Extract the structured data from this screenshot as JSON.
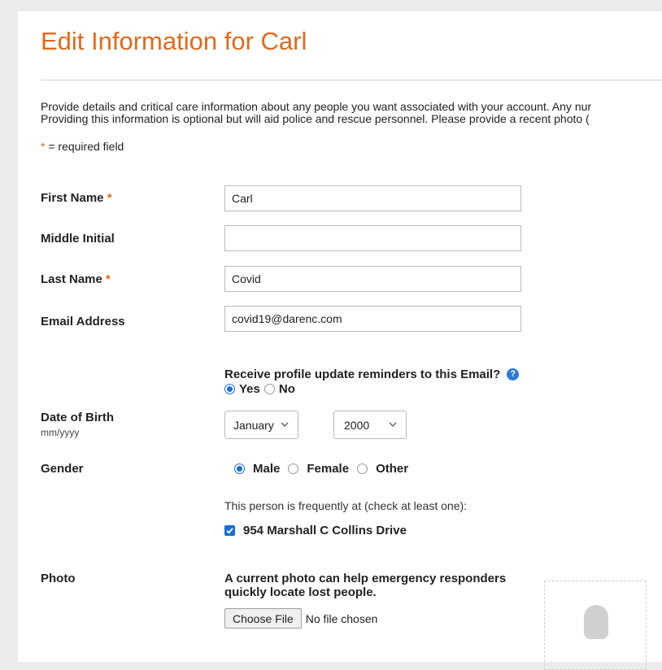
{
  "page": {
    "title": "Edit Information for Carl",
    "intro_line1": "Provide details and critical care information about any people you want associated with your account. Any nur",
    "intro_line2": "Providing this information is optional but will aid police and rescue personnel. Please provide a recent photo (",
    "required_star": "*",
    "required_note": " = required field"
  },
  "form": {
    "first_name": {
      "label": "First Name",
      "required_star": "*",
      "value": "Carl"
    },
    "middle_initial": {
      "label": "Middle Initial",
      "value": ""
    },
    "last_name": {
      "label": "Last Name",
      "required_star": "*",
      "value": "Covid"
    },
    "email": {
      "label": "Email Address",
      "value": "covid19@darenc.com"
    },
    "reminders": {
      "question": "Receive profile update reminders to this Email?",
      "help_glyph": "?",
      "options": [
        {
          "label": "Yes",
          "selected": true
        },
        {
          "label": "No",
          "selected": false
        }
      ]
    },
    "dob": {
      "label": "Date of Birth",
      "format_hint": "mm/yyyy",
      "month": "January",
      "year": "2000"
    },
    "gender": {
      "label": "Gender",
      "options": [
        {
          "label": "Male",
          "selected": true
        },
        {
          "label": "Female",
          "selected": false
        },
        {
          "label": "Other",
          "selected": false
        }
      ]
    },
    "locations": {
      "note": "This person is frequently at (check at least one):",
      "items": [
        {
          "label": "954 Marshall C Collins Drive",
          "checked": true
        }
      ]
    },
    "photo": {
      "label": "Photo",
      "help": "A current photo can help emergency responders quickly locate lost people.",
      "choose_button": "Choose File",
      "status": "No file chosen"
    }
  },
  "colors": {
    "accent": "#e06a1b",
    "control_blue": "#1a6ed8",
    "help_icon_blue": "#2b7bd5"
  },
  "icons": [
    "help-icon",
    "chevron-down-icon",
    "checkmark-icon",
    "person-placeholder-icon"
  ]
}
